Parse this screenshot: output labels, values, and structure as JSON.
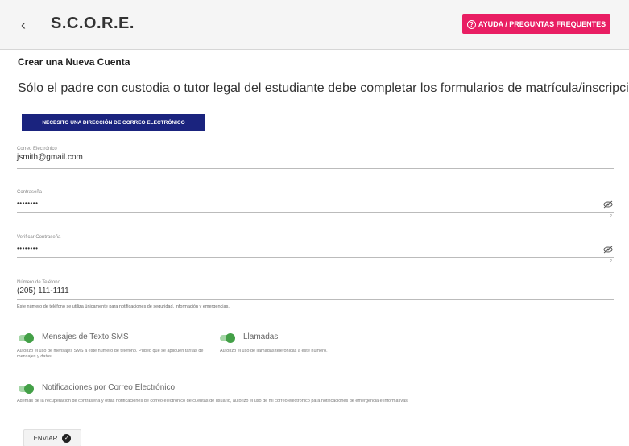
{
  "header": {
    "back_icon": "chevron-left-icon",
    "title": "S.C.O.R.E.",
    "help_label": "AYUDA / PREGUNTAS FREQUENTES",
    "help_color": "#e91e63"
  },
  "form": {
    "heading": "Crear una Nueva Cuenta",
    "intro": "Sólo el padre con custodia o tutor legal del estudiante debe completar los formularios de matrícula/inscripción.",
    "need_email_button": "NECESITO UNA DIRECCIÓN DE CORREO ELECTRÓNICO",
    "need_email_color": "#1a237e",
    "email": {
      "label": "Correo Electrónico",
      "value": "jsmith@gmail.com"
    },
    "password": {
      "label": "Contraseña",
      "value": "••••••••",
      "hint": "?"
    },
    "verify_password": {
      "label": "Verificar Contraseña",
      "value": "••••••••",
      "hint": "?"
    },
    "phone": {
      "label": "Número de Teléfono",
      "value": "(205) 111-1111",
      "helper": "Este número de teléfono se utiliza únicamente para notificaciones de seguridad, información y emergencias."
    },
    "toggles": {
      "sms": {
        "label": "Mensajes de Texto SMS",
        "desc": "Autorizo el uso de mensajes SMS a este número de teléfono. Puded que se apliquen tarifas de mensajes y datos.",
        "on": true
      },
      "calls": {
        "label": "Llamadas",
        "desc": "Autorizo el uso de llamadas telefónicas a este número.",
        "on": true
      },
      "email_notif": {
        "label": "Notificaciones por Correo Electrónico",
        "desc": "Además de la recuperación de contraseña y otras notificaciones de correo electrónico de cuentas de usuario, autorizo el uso de mi correo electrónico para notificaciones de emergencia e informativas.",
        "on": true
      }
    },
    "toggle_color": "#43a047",
    "submit_label": "ENVIAR"
  }
}
